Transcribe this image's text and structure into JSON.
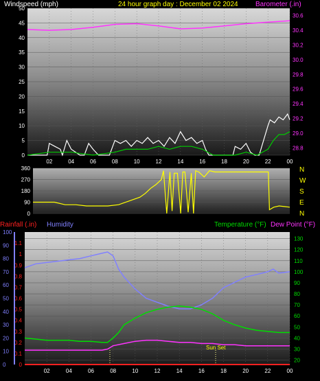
{
  "header": {
    "left_label": "Windspeed (mph)",
    "center_label": "24 hour graph day : December 02 2024",
    "right_label": "Barometer (.in)"
  },
  "colors": {
    "white": "#ffffff",
    "yellow": "#ffff00",
    "magenta": "#ff33ff",
    "green": "#00dd00",
    "blue": "#8080ff",
    "red": "#ff2020",
    "wind_avg": "#00cc00",
    "text_white": "#ffffff"
  },
  "sections": {
    "bottom_left_label": "Rainfall (.in)",
    "bottom_mid_label": "Humidity",
    "bottom_right_label": "Temperature (°F)",
    "bottom_dew_label": "Dew Point (°F)",
    "sunset_label": "Sun Set",
    "compass": [
      "N",
      "W",
      "S",
      "E",
      "N"
    ]
  },
  "chart_data": [
    {
      "type": "line",
      "name": "wind_barometer",
      "x_ticks": [
        "02",
        "04",
        "06",
        "08",
        "10",
        "12",
        "14",
        "16",
        "18",
        "20",
        "22",
        "00"
      ],
      "y_left_ticks": [
        "0",
        "5",
        "10",
        "15",
        "20",
        "25",
        "30",
        "35",
        "40",
        "45",
        "50"
      ],
      "y_left_range": [
        0,
        50
      ],
      "y_right_ticks": [
        "28.8",
        "29.0",
        "29.2",
        "29.4",
        "29.6",
        "29.8",
        "30.0",
        "30.2",
        "30.4",
        "30.6"
      ],
      "y_right_range": [
        28.7,
        30.7
      ],
      "x_range": [
        0,
        24
      ],
      "series": [
        {
          "name": "Barometer",
          "axis": "right",
          "color": "#ff33ff",
          "x": [
            0,
            2,
            4,
            6,
            8,
            10,
            12,
            14,
            16,
            18,
            20,
            22,
            24
          ],
          "y": [
            30.41,
            30.4,
            30.41,
            30.44,
            30.48,
            30.49,
            30.46,
            30.42,
            30.43,
            30.46,
            30.49,
            30.51,
            30.53
          ]
        },
        {
          "name": "Wind gust",
          "axis": "left",
          "color": "#ffffff",
          "x": [
            0,
            1.8,
            2.0,
            2.5,
            3.0,
            3.2,
            3.6,
            4.0,
            4.8,
            5.2,
            5.6,
            6.0,
            6.5,
            7.5,
            8.0,
            8.5,
            9.0,
            9.5,
            10.0,
            10.5,
            11,
            11.5,
            12,
            12.5,
            13,
            13.5,
            14,
            14.5,
            15,
            15.5,
            16,
            16.3,
            16.6,
            18.8,
            19.0,
            19.5,
            20.0,
            20.4,
            20.8,
            21.2,
            22.0,
            22.2,
            22.6,
            23.0,
            23.4,
            23.8,
            24
          ],
          "y": [
            0,
            0,
            4,
            3,
            2,
            0,
            5,
            2,
            0,
            0,
            4,
            2,
            0,
            0,
            5,
            4,
            5,
            3,
            5,
            4,
            6,
            4,
            5,
            3,
            6,
            4,
            8,
            5,
            6,
            4,
            5,
            2,
            0,
            0,
            3,
            2,
            4,
            1,
            0,
            0,
            10,
            12,
            11,
            13,
            12,
            14,
            12
          ]
        },
        {
          "name": "Wind avg",
          "axis": "left",
          "color": "#00cc00",
          "x": [
            0,
            2,
            3,
            4,
            6,
            8,
            9,
            10,
            11,
            12,
            13,
            14,
            15,
            16,
            17,
            19,
            20,
            21,
            22,
            22.5,
            23,
            23.5,
            24
          ],
          "y": [
            0,
            1,
            1,
            1,
            0,
            1,
            2,
            2,
            2,
            3,
            2,
            3,
            3,
            2,
            0,
            0,
            1,
            0,
            2,
            5,
            7,
            7,
            8
          ]
        }
      ]
    },
    {
      "type": "line",
      "name": "wind_direction",
      "y_ticks": [
        "0",
        "90",
        "180",
        "270",
        "360"
      ],
      "y_range": [
        0,
        360
      ],
      "x_range": [
        0,
        24
      ],
      "series": [
        {
          "name": "Wind direction",
          "color": "#ffff00",
          "x": [
            0,
            2,
            3,
            4,
            5,
            6,
            7,
            8,
            9,
            10,
            10.5,
            11,
            11.5,
            12,
            12.2,
            12.5,
            12.8,
            13,
            13.2,
            13.5,
            13.8,
            14,
            14.2,
            14.5,
            14.8,
            15,
            15.2,
            15.5,
            16,
            16.5,
            17,
            18,
            19,
            20,
            21,
            22,
            22.1,
            22.5,
            23,
            23.5,
            24
          ],
          "y": [
            90,
            90,
            70,
            70,
            60,
            60,
            60,
            70,
            100,
            130,
            160,
            200,
            230,
            270,
            340,
            0,
            330,
            20,
            320,
            320,
            0,
            330,
            330,
            10,
            320,
            0,
            340,
            330,
            290,
            340,
            330,
            330,
            330,
            330,
            330,
            330,
            30,
            50,
            60,
            55,
            50
          ]
        }
      ]
    },
    {
      "type": "line",
      "name": "temp_humidity_rain",
      "x_ticks": [
        "02",
        "04",
        "06",
        "08",
        "10",
        "12",
        "14",
        "16",
        "18",
        "20",
        "22",
        "00"
      ],
      "x_range": [
        0,
        24
      ],
      "y_humidity_ticks": [
        "0",
        "10",
        "20",
        "30",
        "40",
        "50",
        "60",
        "70",
        "80",
        "90",
        "100"
      ],
      "y_humidity_range": [
        0,
        100
      ],
      "y_rain_ticks": [
        "0",
        "0.1",
        "0.2",
        "0.3",
        "0.4",
        "0.5",
        "0.6",
        "0.7",
        "0.8",
        "0.9",
        "1",
        "1.1"
      ],
      "y_rain_range": [
        0,
        1.2
      ],
      "y_temp_ticks": [
        "20",
        "30",
        "40",
        "50",
        "60",
        "70",
        "80",
        "90",
        "100",
        "110",
        "120",
        "130"
      ],
      "y_temp_range": [
        16,
        136
      ],
      "series": [
        {
          "name": "Humidity",
          "axis": "humidity",
          "color": "#8080ff",
          "x": [
            0,
            1,
            2,
            3,
            4,
            5,
            6,
            7,
            7.5,
            8,
            8.5,
            9,
            10,
            11,
            12,
            13,
            14,
            15,
            16,
            17,
            18,
            19,
            20,
            21,
            22,
            22.5,
            23,
            24
          ],
          "y": [
            73,
            76,
            77,
            78,
            79,
            80,
            82,
            84,
            85,
            82,
            72,
            66,
            57,
            50,
            47,
            44,
            42,
            42,
            45,
            50,
            58,
            62,
            66,
            68,
            70,
            72,
            69,
            70
          ]
        },
        {
          "name": "Temperature",
          "axis": "temp",
          "color": "#00dd00",
          "x": [
            0,
            1,
            2,
            3,
            4,
            5,
            6,
            7,
            7.5,
            8,
            8.5,
            9,
            10,
            11,
            12,
            13,
            14,
            15,
            16,
            17,
            18,
            19,
            20,
            21,
            22,
            23,
            24
          ],
          "y": [
            40,
            39,
            38,
            38,
            38,
            37,
            37,
            36,
            36,
            40,
            45,
            52,
            58,
            63,
            66,
            68,
            69,
            68,
            66,
            62,
            56,
            52,
            49,
            47,
            46,
            45,
            45
          ]
        },
        {
          "name": "Dew Point",
          "axis": "temp",
          "color": "#ff33ff",
          "x": [
            0,
            1,
            2,
            4,
            6,
            7,
            7.5,
            8,
            9,
            10,
            11,
            12,
            13,
            14,
            15,
            16,
            17,
            18,
            19,
            20,
            21,
            22,
            23,
            24
          ],
          "y": [
            29,
            29,
            29,
            29,
            29,
            29,
            30,
            33,
            35,
            37,
            38,
            38,
            37,
            36,
            36,
            35,
            35,
            34,
            34,
            33,
            33,
            33,
            33,
            33
          ]
        },
        {
          "name": "Rainfall",
          "axis": "rain",
          "color": "#ff2020",
          "x": [
            0,
            24
          ],
          "y": [
            0,
            0
          ]
        }
      ]
    }
  ]
}
